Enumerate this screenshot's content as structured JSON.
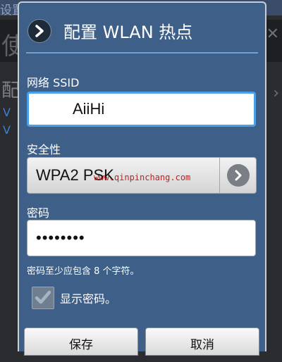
{
  "background": {
    "title_fragment": "设置 WLAN 热点设置",
    "big_letter": "使",
    "mid_letter": "配",
    "link_letters": [
      "V",
      "V"
    ],
    "right_icons": [
      "✕",
      "›"
    ]
  },
  "dialog": {
    "title": "配置 WLAN 热点",
    "ssid": {
      "label": "网络 SSID",
      "value": "AiiHi"
    },
    "security": {
      "label": "安全性",
      "value": "WPA2 PSK"
    },
    "password": {
      "label": "密码",
      "value": "••••••••"
    },
    "hint": "密码至少应包含 8 个字符。",
    "show_password": {
      "label": "显示密码。",
      "checked": true
    },
    "buttons": {
      "save": "保存",
      "cancel": "取消"
    }
  },
  "watermark": "www.qinpinchang.com",
  "icons": {
    "back": "chevron-right-icon",
    "select_arrow": "chevron-right-icon",
    "checkbox": "checkmark-icon"
  },
  "colors": {
    "dialog_bg": "#3e5f88",
    "accent": "#6fa1d9",
    "focus_border": "#4aa0e8",
    "watermark": "#c81e1e"
  }
}
